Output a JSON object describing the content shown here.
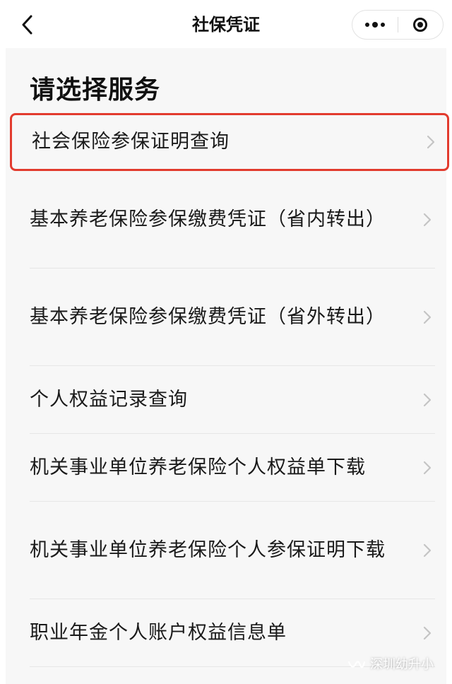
{
  "nav": {
    "title": "社保凭证",
    "back_icon": "chevron-left-icon",
    "menu_icon": "more-dots-icon",
    "close_icon": "miniprogram-close-icon"
  },
  "heading": "请选择服务",
  "items": [
    {
      "label": "社会保险参保证明查询",
      "highlighted": true
    },
    {
      "label": "基本养老保险参保缴费凭证（省内转出）"
    },
    {
      "label": "基本养老保险参保缴费凭证（省外转出）"
    },
    {
      "label": "个人权益记录查询"
    },
    {
      "label": "机关事业单位养老保险个人权益单下载"
    },
    {
      "label": "机关事业单位养老保险个人参保证明下载"
    },
    {
      "label": "职业年金个人账户权益信息单"
    }
  ],
  "watermark": {
    "text": "深圳幼升小",
    "icon": "wechat-channel-icon"
  },
  "colors": {
    "highlight": "#e23b2e",
    "panel_bg": "#f7f7f7"
  }
}
